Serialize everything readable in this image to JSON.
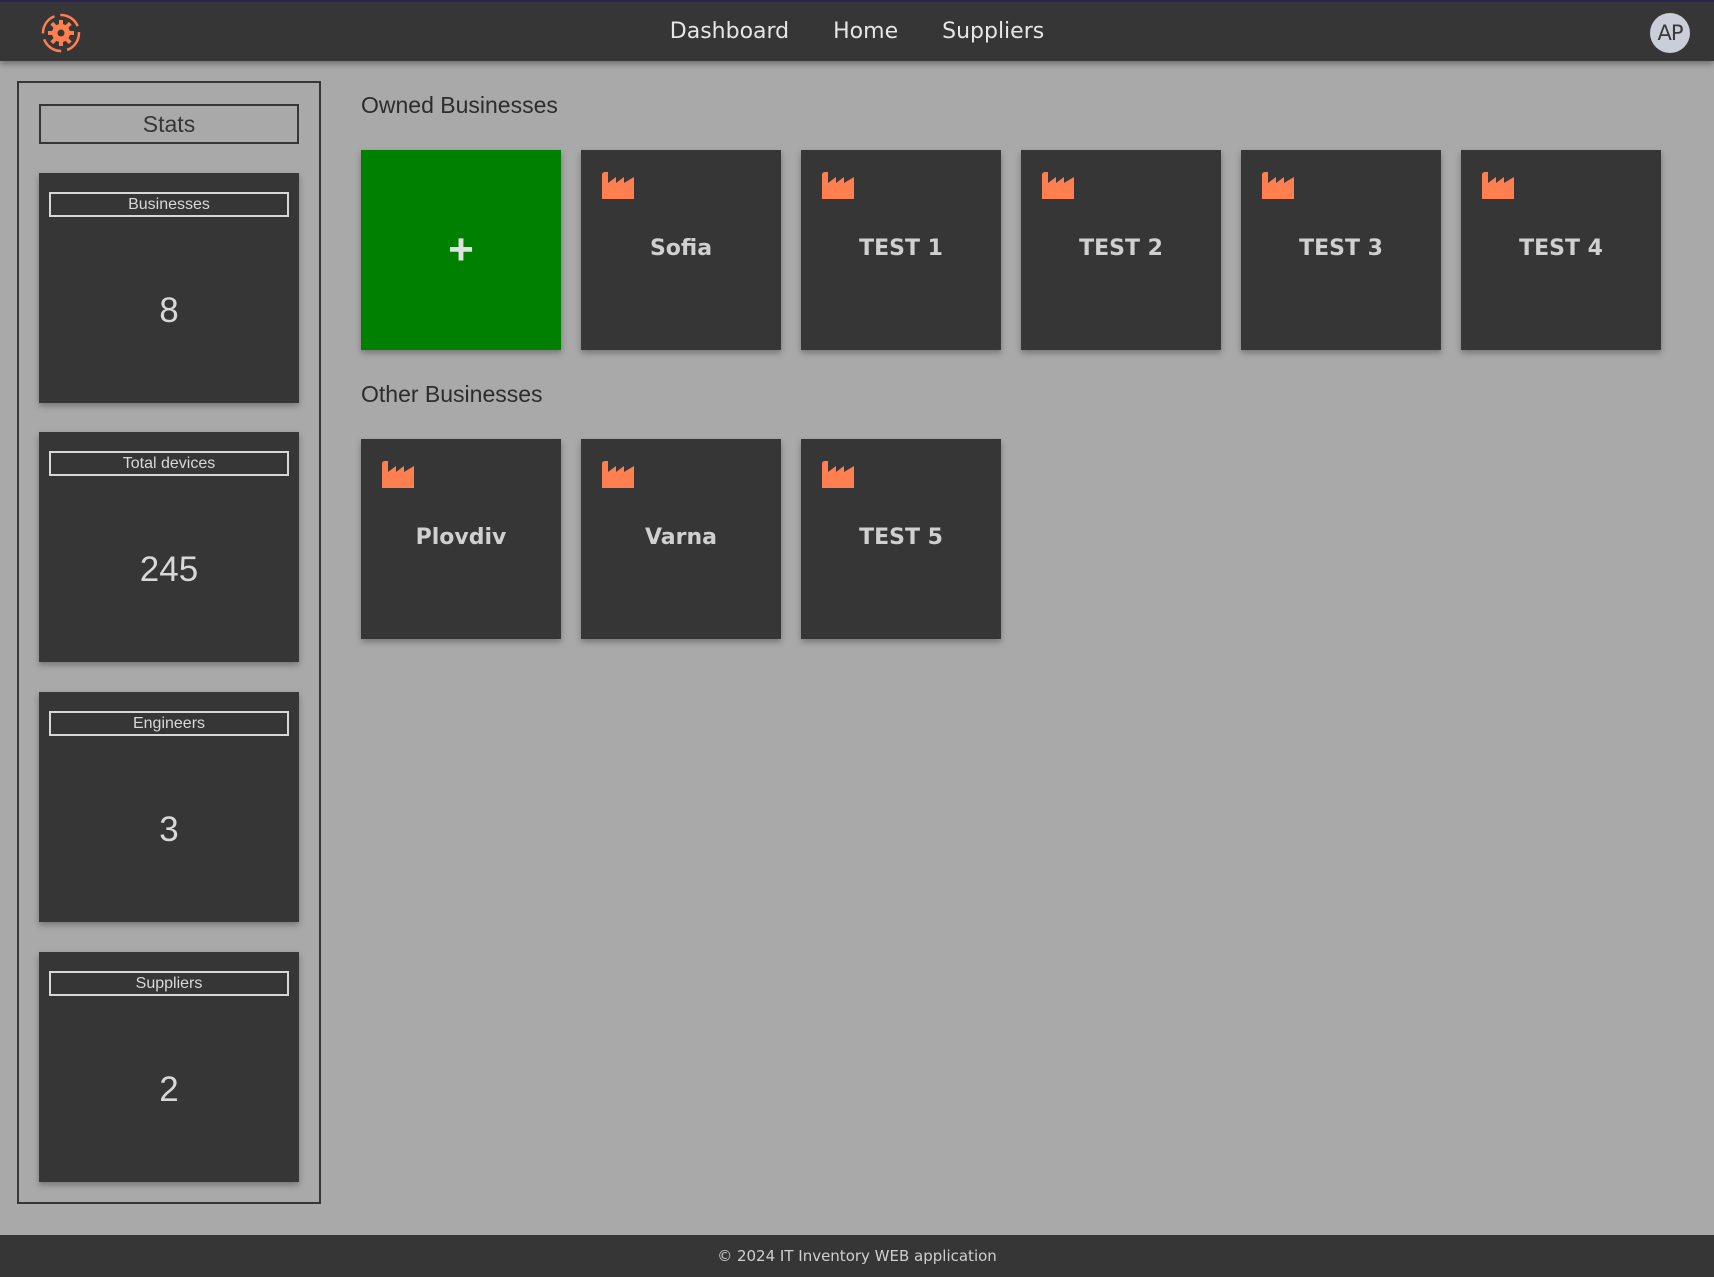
{
  "nav": {
    "items": [
      {
        "label": "Dashboard"
      },
      {
        "label": "Home"
      },
      {
        "label": "Suppliers"
      }
    ],
    "avatar_initials": "AP"
  },
  "stats": {
    "title": "Stats",
    "cards": [
      {
        "label": "Businesses",
        "value": "8"
      },
      {
        "label": "Total devices",
        "value": "245"
      },
      {
        "label": "Engineers",
        "value": "3"
      },
      {
        "label": "Suppliers",
        "value": "2"
      }
    ]
  },
  "owned": {
    "title": "Owned Businesses",
    "add_symbol": "+",
    "items": [
      {
        "name": "Sofia"
      },
      {
        "name": "TEST 1"
      },
      {
        "name": "TEST 2"
      },
      {
        "name": "TEST 3"
      },
      {
        "name": "TEST 4"
      }
    ]
  },
  "other": {
    "title": "Other Businesses",
    "items": [
      {
        "name": "Plovdiv"
      },
      {
        "name": "Varna"
      },
      {
        "name": "TEST 5"
      }
    ]
  },
  "footer": {
    "text": "© 2024 IT Inventory WEB application"
  },
  "colors": {
    "accent": "#ff7f50",
    "add_tile": "#008000",
    "panel": "#363636",
    "background": "#a9a9a9"
  },
  "icons": {
    "logo": "gear-logo-icon",
    "business": "factory-icon"
  }
}
